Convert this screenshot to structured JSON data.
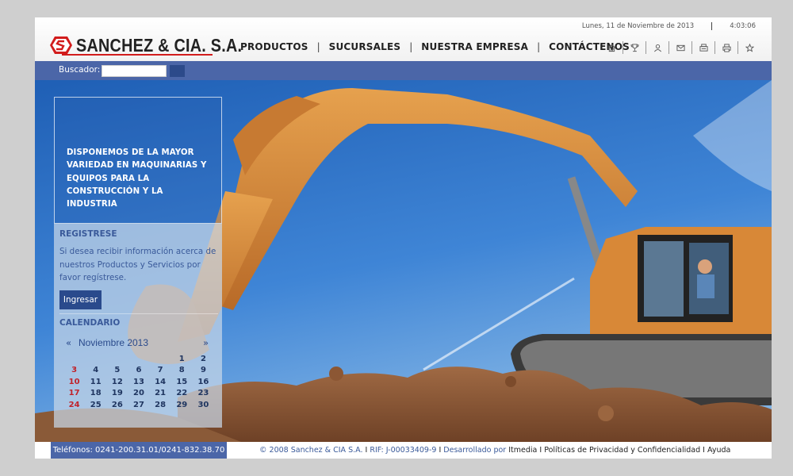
{
  "header": {
    "brand": "SANCHEZ & CIA. S.A.",
    "date": "Lunes, 11 de Noviembre de 2013",
    "time": "4:03:06",
    "nav": [
      "PRODUCTOS",
      "SUCURSALES",
      "NUESTRA EMPRESA",
      "CONTÁCTENOS"
    ],
    "tools": [
      "home-icon",
      "trophy-icon",
      "user-icon",
      "mail-icon",
      "fax-icon",
      "print-icon",
      "star-icon"
    ]
  },
  "search": {
    "label": "Buscador:",
    "value": ""
  },
  "hero": {
    "tagline": "DISPONEMOS DE LA MAYOR VARIEDAD EN MAQUINARIAS Y EQUIPOS PARA LA CONSTRUCCIÓN Y LA INDUSTRIA"
  },
  "register": {
    "title": "REGISTRESE",
    "text": "Si desea recibir información acerca de nuestros Productos y Servicios por favor regístrese.",
    "button": "Ingresar"
  },
  "calendar": {
    "title": "CALENDARIO",
    "prev": "«",
    "next": "»",
    "month": "Noviembre 2013",
    "weeks": [
      [
        "",
        "",
        "",
        "",
        "",
        "1",
        "2"
      ],
      [
        "3",
        "4",
        "5",
        "6",
        "7",
        "8",
        "9"
      ],
      [
        "10",
        "11",
        "12",
        "13",
        "14",
        "15",
        "16"
      ],
      [
        "17",
        "18",
        "19",
        "20",
        "21",
        "22",
        "23"
      ],
      [
        "24",
        "25",
        "26",
        "27",
        "28",
        "29",
        "30"
      ]
    ]
  },
  "footer": {
    "phones": "Teléfonos: 0241-200.31.01/0241-832.38.70",
    "copyright": "© 2008 Sanchez & CIA S.A.",
    "rif": "RIF: J-00033409-9",
    "developed_by": "Desarrollado por",
    "developer": "Itmedia",
    "privacy": "Políticas de Privacidad y Confidencialidad",
    "help": "Ayuda",
    "separator": "I"
  },
  "colors": {
    "brand_blue": "#4b66a8",
    "brand_red": "#d21c1c",
    "dirt": "#8a5a38",
    "machine": "#d98a3a"
  }
}
